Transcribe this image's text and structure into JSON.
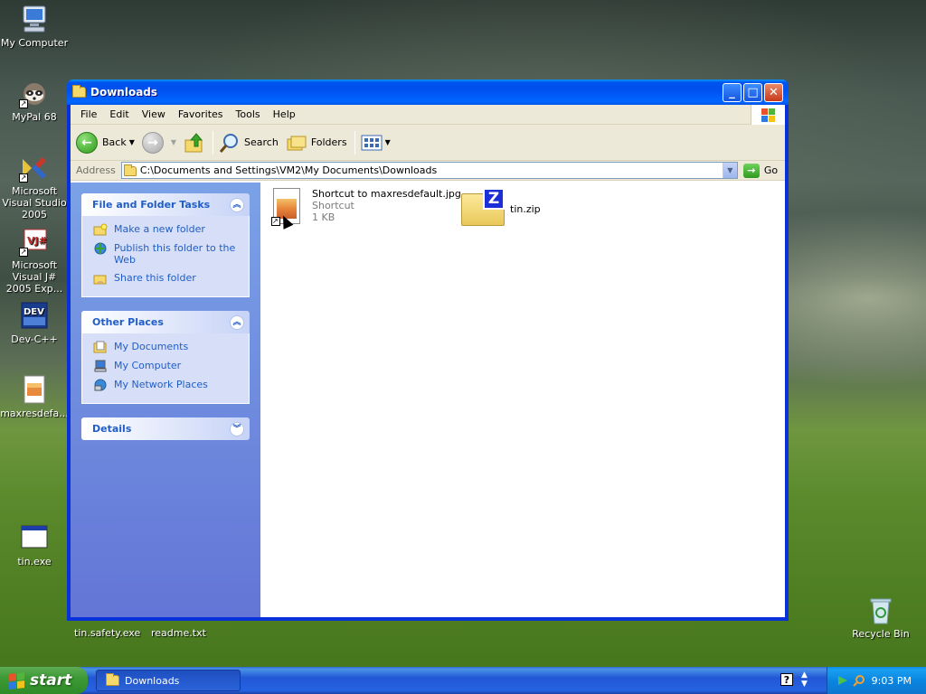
{
  "desktop": {
    "icons": [
      {
        "label": "My Computer"
      },
      {
        "label": "MyPal 68"
      },
      {
        "label": "Microsoft Visual Studio 2005"
      },
      {
        "label": "Microsoft Visual J# 2005 Exp..."
      },
      {
        "label": "Dev-C++"
      },
      {
        "label": "maxresdefa..."
      },
      {
        "label": "tin.exe"
      },
      {
        "label": "Recycle Bin"
      }
    ],
    "bottom_labels": [
      "tin.safety.exe",
      "readme.txt"
    ]
  },
  "window": {
    "title": "Downloads",
    "menu": [
      "File",
      "Edit",
      "View",
      "Favorites",
      "Tools",
      "Help"
    ],
    "toolbar": {
      "back_label": "Back",
      "search_label": "Search",
      "folders_label": "Folders"
    },
    "address": {
      "label": "Address",
      "value": "C:\\Documents and Settings\\VM2\\My Documents\\Downloads",
      "go_label": "Go"
    },
    "taskpane": {
      "file_tasks": {
        "title": "File and Folder Tasks",
        "items": [
          "Make a new folder",
          "Publish this folder to the Web",
          "Share this folder"
        ]
      },
      "other_places": {
        "title": "Other Places",
        "items": [
          "My Documents",
          "My Computer",
          "My Network Places"
        ]
      },
      "details": {
        "title": "Details"
      }
    },
    "files": [
      {
        "name": "Shortcut to maxresdefault.jpg",
        "type": "Shortcut",
        "size": "1 KB"
      },
      {
        "name": "tin.zip"
      }
    ]
  },
  "taskbar": {
    "start_label": "start",
    "task_button": "Downloads",
    "clock": "9:03 PM"
  },
  "colors": {
    "title_blue": "#0053ee",
    "taskpane_link": "#215dc6",
    "start_green": "#3c9a34",
    "taskbar_blue": "#2157d7"
  }
}
